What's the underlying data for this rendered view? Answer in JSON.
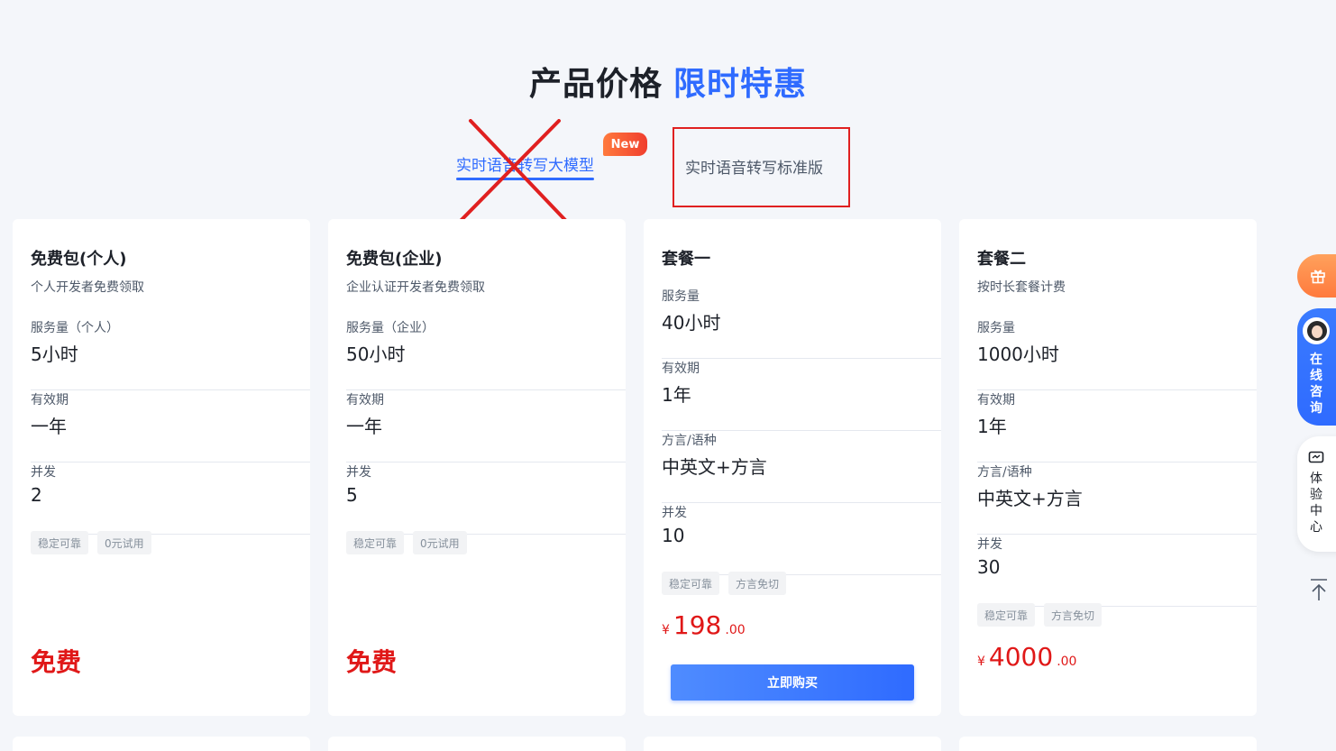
{
  "header": {
    "title_main": "产品价格",
    "title_highlight": "限时特惠"
  },
  "tabs": {
    "llm_label": "实时语音转写大模型",
    "new_badge": "New",
    "standard_label": "实时语音转写标准版"
  },
  "cards": [
    {
      "name": "免费包(个人)",
      "desc": "个人开发者免费领取",
      "rows": [
        {
          "label": "服务量（个人）",
          "value": "5小时"
        },
        {
          "label": "有效期",
          "value": "一年"
        },
        {
          "label": "并发",
          "value": "2"
        }
      ],
      "tags": [
        "稳定可靠",
        "0元试用"
      ],
      "price_text": "免费"
    },
    {
      "name": "免费包(企业)",
      "desc": "企业认证开发者免费领取",
      "rows": [
        {
          "label": "服务量（企业）",
          "value": "50小时"
        },
        {
          "label": "有效期",
          "value": "一年"
        },
        {
          "label": "并发",
          "value": "5"
        }
      ],
      "tags": [
        "稳定可靠",
        "0元试用"
      ],
      "price_text": "免费"
    },
    {
      "name": "套餐一",
      "rows": [
        {
          "label": "服务量",
          "value": "40小时"
        },
        {
          "label": "有效期",
          "value": "1年"
        },
        {
          "label": "方言/语种",
          "value": "中英文+方言"
        },
        {
          "label": "并发",
          "value": "10"
        }
      ],
      "tags": [
        "稳定可靠",
        "方言免切"
      ],
      "price": {
        "currency": "¥",
        "integer": "198",
        "decimal": ".00"
      },
      "buy_label": "立即购买"
    },
    {
      "name": "套餐二",
      "desc": "按时长套餐计费",
      "rows": [
        {
          "label": "服务量",
          "value": "1000小时"
        },
        {
          "label": "有效期",
          "value": "1年"
        },
        {
          "label": "方言/语种",
          "value": "中英文+方言"
        },
        {
          "label": "并发",
          "value": "30"
        }
      ],
      "tags": [
        "稳定可靠",
        "方言免切"
      ],
      "price": {
        "currency": "¥",
        "integer": "4000",
        "decimal": ".00"
      }
    }
  ],
  "sidebar": {
    "consult_label": "在线咨询",
    "experience_label": "体验中心"
  },
  "icons": [
    "gift-icon",
    "avatar",
    "monitor-icon",
    "back-to-top-icon"
  ],
  "colors": {
    "accent": "#2f6bff",
    "price_red": "#e01818",
    "annotation_red": "#e02020"
  }
}
